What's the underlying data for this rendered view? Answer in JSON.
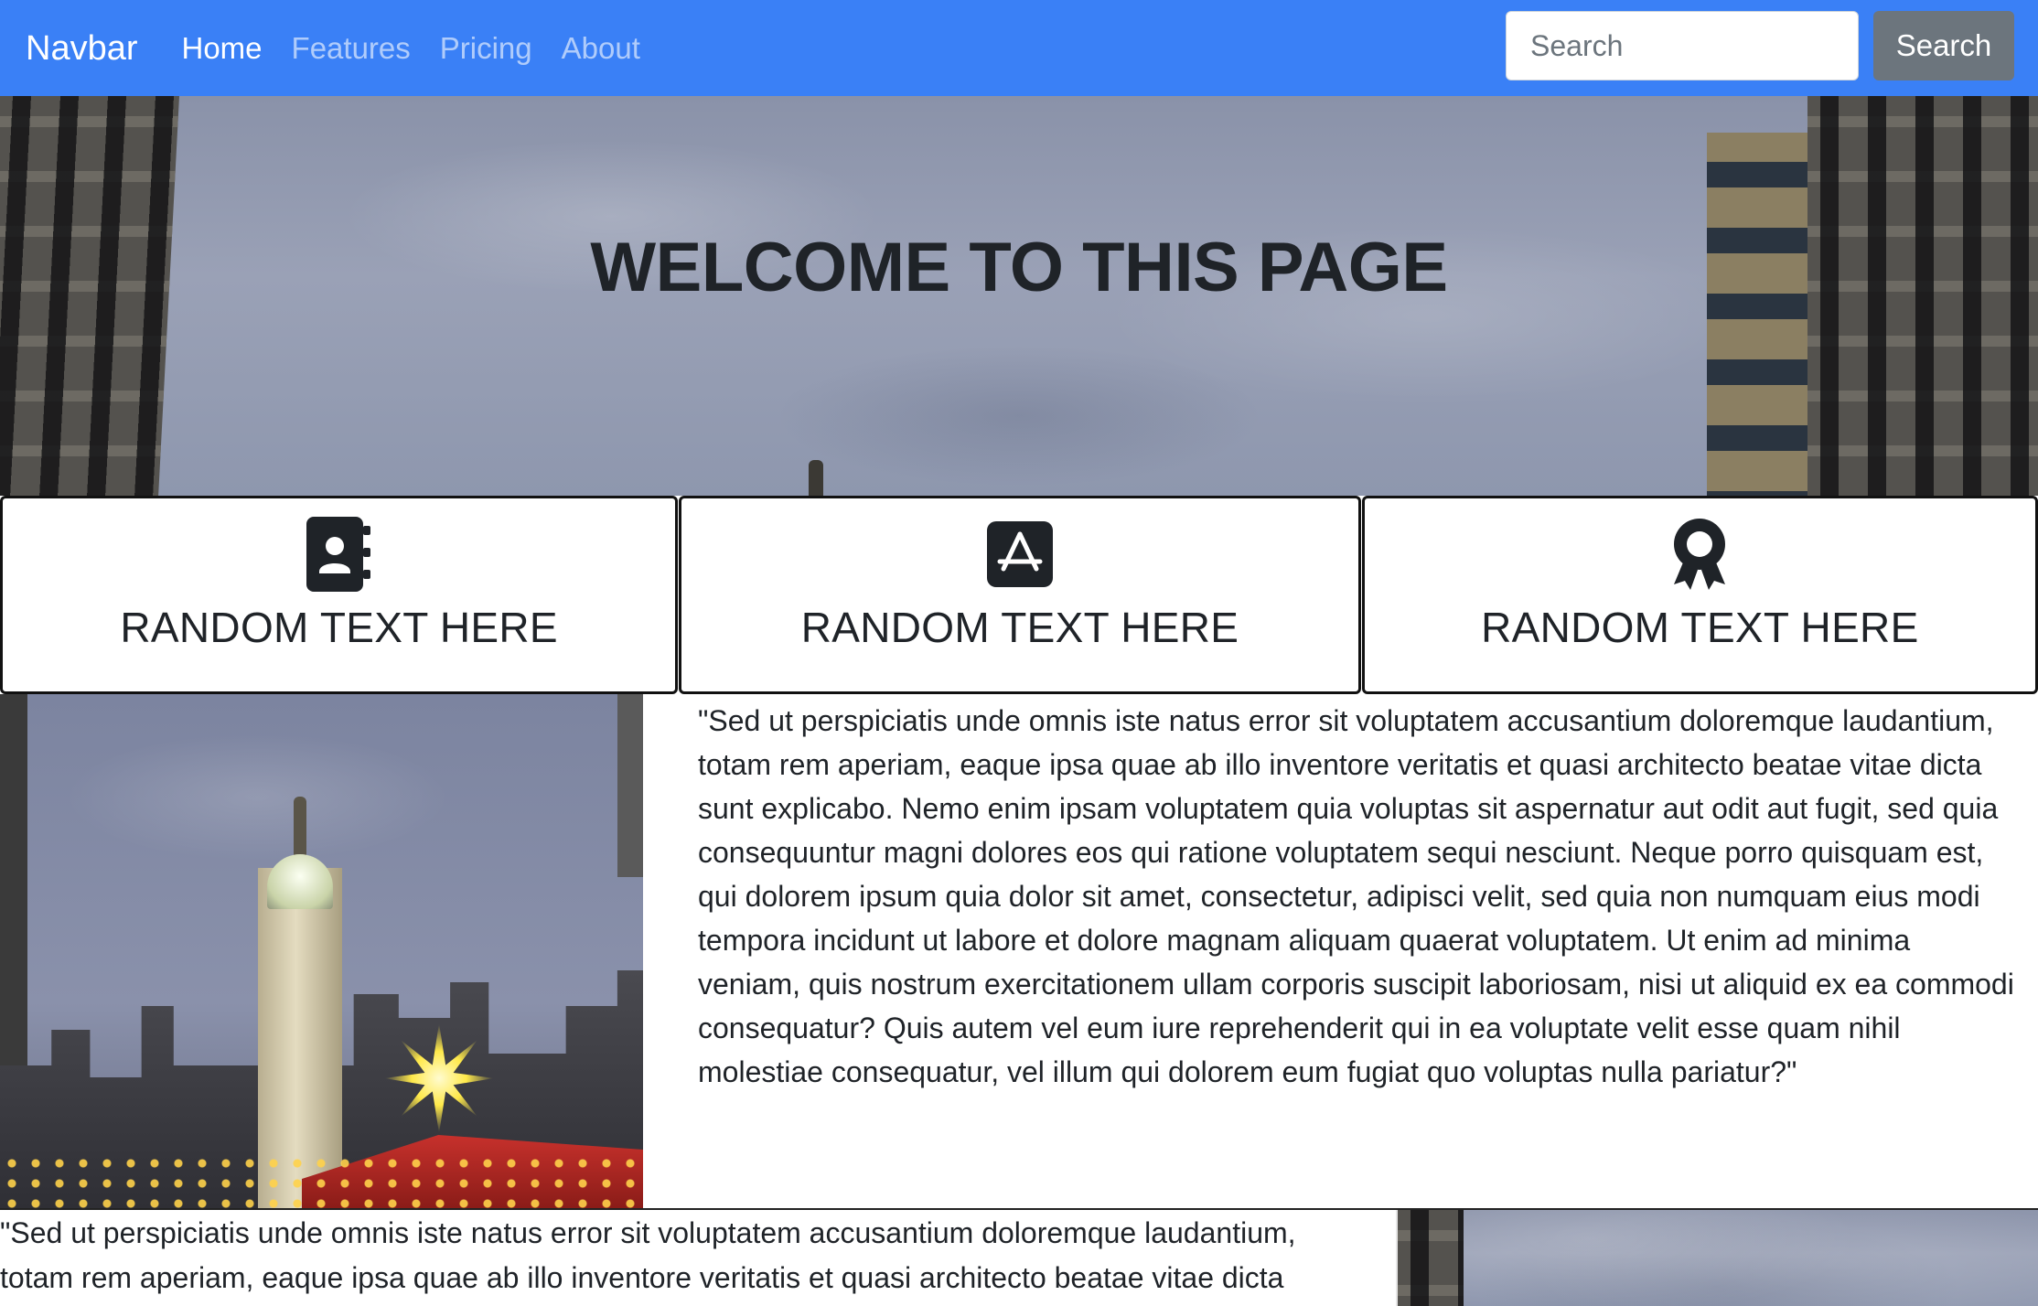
{
  "navbar": {
    "brand": "Navbar",
    "links": [
      {
        "label": "Home",
        "active": true
      },
      {
        "label": "Features",
        "active": false
      },
      {
        "label": "Pricing",
        "active": false
      },
      {
        "label": "About",
        "active": false
      }
    ],
    "search_placeholder": "Search",
    "search_button": "Search",
    "colors": {
      "background": "#3a80f6",
      "button": "#6c757d"
    }
  },
  "hero": {
    "title": "WELCOME TO THIS PAGE",
    "background_image": "cloudy sky between buildings"
  },
  "cards": [
    {
      "icon": "address-book-icon",
      "label": "RANDOM TEXT HERE"
    },
    {
      "icon": "app-store-icon",
      "label": "RANDOM TEXT HERE"
    },
    {
      "icon": "award-ribbon-icon",
      "label": "RANDOM TEXT HERE"
    }
  ],
  "content": {
    "image": "city hall clock tower with christmas market at dusk",
    "paragraph_lines": [
      "\"Sed ut perspiciatis unde omnis iste natus error sit voluptatem accusantium doloremque laudantium,",
      "totam rem aperiam, eaque ipsa quae ab illo inventore veritatis et quasi architecto beatae vitae dicta",
      "sunt explicabo. Nemo enim ipsam voluptatem quia voluptas sit aspernatur aut odit aut fugit, sed quia",
      "consequuntur magni dolores eos qui ratione voluptatem sequi nesciunt. Neque porro quisquam est,",
      "qui dolorem ipsum quia dolor sit amet, consectetur, adipisci velit, sed quia non numquam eius modi",
      "tempora incidunt ut labore et dolore magnam aliquam quaerat voluptatem. Ut enim ad minima",
      "veniam, quis nostrum exercitationem ullam corporis suscipit laboriosam, nisi ut aliquid ex ea commodi",
      "consequatur? Quis autem vel eum iure reprehenderit qui in ea voluptate velit esse quam nihil",
      "molestiae consequatur, vel illum qui dolorem eum fugiat quo voluptas nulla pariatur?\""
    ]
  },
  "bottom": {
    "paragraph_lines": [
      "\"Sed ut perspiciatis unde omnis iste natus error sit voluptatem accusantium doloremque laudantium,",
      "totam rem aperiam, eaque ipsa quae ab illo inventore veritatis et quasi architecto beatae vitae dicta"
    ]
  }
}
